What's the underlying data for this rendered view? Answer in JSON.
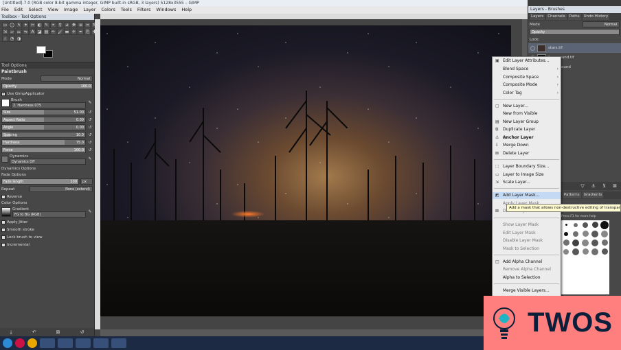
{
  "window": {
    "title": "[Untitled]-7.0 (RGB color 8-bit gamma integer, GIMP built-in sRGB, 3 layers) 5128x3555 – GIMP"
  },
  "menubar": [
    "File",
    "Edit",
    "Select",
    "View",
    "Image",
    "Layer",
    "Colors",
    "Tools",
    "Filters",
    "Windows",
    "Help"
  ],
  "toolbox": {
    "title": "Toolbox - Tool Options",
    "tool_options_tab": "Tool Options",
    "tool_name": "Paintbrush",
    "mode_label": "Mode",
    "mode_value": "Normal",
    "opacity_label": "Opacity",
    "opacity_value": "100.0",
    "use_applicator": "Use GimpApplicator",
    "brush_label": "Brush",
    "brush_value": "2. Hardness 075",
    "size_label": "Size",
    "size_value": "51.00",
    "aspect_label": "Aspect Ratio",
    "aspect_value": "0.00",
    "angle_label": "Angle",
    "angle_value": "0.00",
    "spacing_label": "Spacing",
    "spacing_value": "10.0",
    "hardness_label": "Hardness",
    "hardness_value": "75.0",
    "force_label": "Force",
    "force_value": "100.0",
    "dynamics_label": "Dynamics",
    "dynamics_value": "Dynamics Off",
    "dynamics_options": "Dynamics Options",
    "fade_options": "Fade Options",
    "fade_length_label": "Fade length",
    "fade_length_value": "100",
    "fade_unit": "px",
    "repeat_label": "Repeat",
    "repeat_value": "None (extend)",
    "reverse": "Reverse",
    "color_options": "Color Options",
    "gradient_label": "Gradient",
    "gradient_value": "FG to BG (RGB)",
    "apply_jitter": "Apply Jitter",
    "smooth_stroke": "Smooth stroke",
    "lock_brush": "Lock brush to view",
    "incremental": "Incremental"
  },
  "layers_panel": {
    "title": "Layers - Brushes",
    "tabs": [
      "Layers",
      "Channels",
      "Paths",
      "Undo History"
    ],
    "mode_label": "Mode",
    "mode_value": "Normal",
    "opacity_label": "Opacity",
    "lock_label": "Lock:",
    "layers": [
      "stars.tif",
      "foreground.tif",
      "Background"
    ],
    "bottom_tabs": [
      "Patterns",
      "Gradients"
    ],
    "brush_footer": "Press F1 for more help"
  },
  "context_menu": {
    "items": [
      "Edit Layer Attributes...",
      "Blend Space",
      "Composite Space",
      "Composite Mode",
      "Color Tag",
      "New Layer...",
      "New from Visible",
      "New Layer Group",
      "Duplicate Layer",
      "Anchor Layer",
      "Merge Down",
      "Delete Layer",
      "Layer Boundary Size...",
      "Layer to Image Size",
      "Scale Layer...",
      "Add Layer Mask...",
      "Apply Layer Mask",
      "Delete Layer Mask",
      "Show Layer Mask",
      "Edit Layer Mask",
      "Disable Layer Mask",
      "Mask to Selection",
      "Add Alpha Channel",
      "Remove Alpha Channel",
      "Alpha to Selection",
      "Merge Visible Layers..."
    ],
    "tooltip": "Add a mask that allows non-destructive editing of transparency"
  },
  "watermark": {
    "text": "TWOS"
  }
}
